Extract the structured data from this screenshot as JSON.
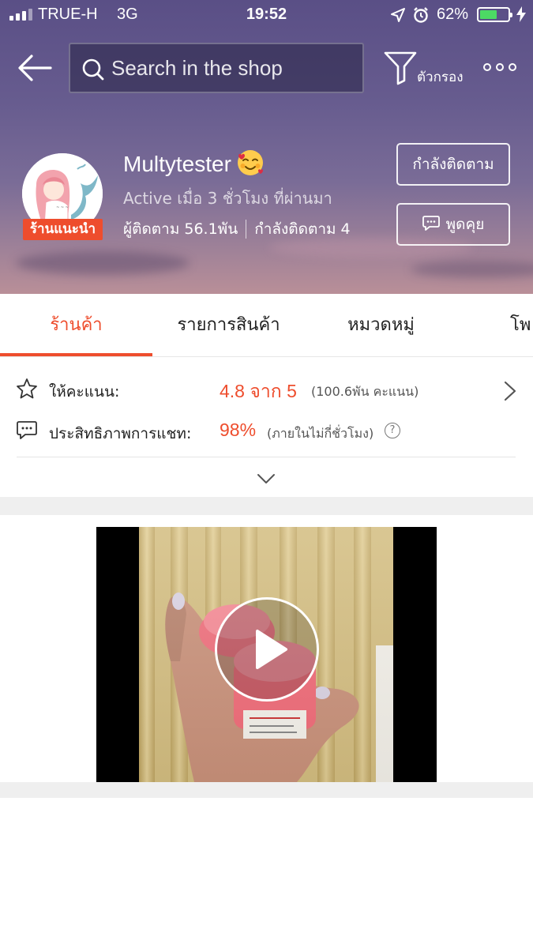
{
  "status_bar": {
    "carrier": "TRUE-H",
    "network": "3G",
    "time": "19:52",
    "battery_percent": "62%",
    "battery_level": 0.62
  },
  "nav": {
    "search_placeholder": "Search in the shop",
    "filter_label": "ตัวกรอง",
    "icons": [
      "back-arrow-icon",
      "search-icon",
      "filter-icon",
      "more-icon"
    ]
  },
  "shop": {
    "name": "Multytester",
    "name_emoji": "smiling-face-with-hearts",
    "active_text": "Active เมื่อ 3 ชั่วโมง ที่ผ่านมา",
    "followers_text": "ผู้ติดตาม 56.1พัน",
    "following_text": "กำลังติดตาม 4",
    "preferred_badge": "ร้านแนะนำ",
    "follow_button": "กำลังติดตาม",
    "chat_button": "พูดคุย"
  },
  "tabs": [
    {
      "label": "ร้านค้า",
      "active": true
    },
    {
      "label": "รายการสินค้า",
      "active": false
    },
    {
      "label": "หมวดหมู่",
      "active": false
    },
    {
      "label": "โพ",
      "active": false
    }
  ],
  "ratings": {
    "rating_label": "ให้คะแนน:",
    "rating_value": "4.8 จาก 5",
    "rating_count": "(100.6พัน คะแนน)",
    "chat_label": "ประสิทธิภาพการแชท:",
    "chat_value": "98%",
    "chat_sub": "(ภายในไม่กี่ชั่วโมง)",
    "help_symbol": "?"
  },
  "colors": {
    "accent": "#ee4d2d",
    "header_top": "#5a4f86",
    "header_bottom": "#b98f98"
  }
}
